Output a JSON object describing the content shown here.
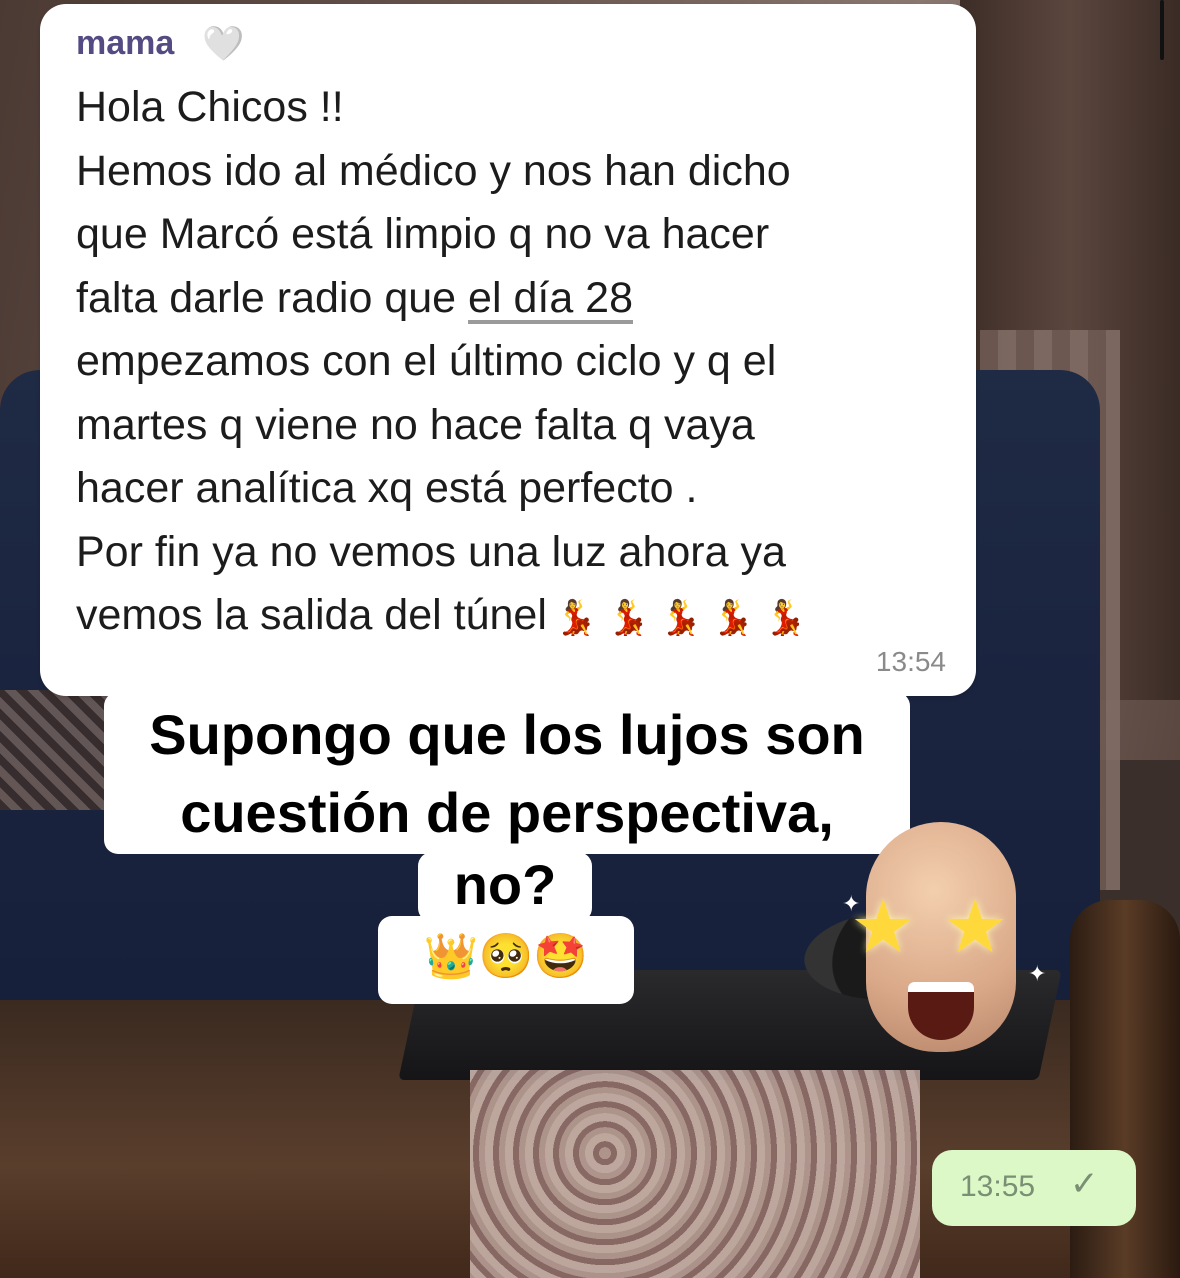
{
  "chat": {
    "incoming": {
      "sender": "mama",
      "sender_emoji": "🤍",
      "lines": [
        "Hola Chicos !!",
        "Hemos ido al médico y nos han dicho",
        "que Marcó está limpio q no va hacer",
        "falta darle radio que ",
        "el día 28",
        "empezamos con el último ciclo y q el",
        "martes q viene no hace falta q vaya",
        "hacer analítica xq está perfecto .",
        "Por fin ya no vemos una luz ahora ya",
        "vemos la salida del túnel"
      ],
      "emojis": "💃💃💃💃💃",
      "time": "13:54"
    },
    "outgoing": {
      "time": "13:55",
      "status_icon": "check-icon"
    }
  },
  "caption": {
    "line1": "Supongo que los lujos son",
    "line2": "cuestión de perspectiva,",
    "line3": "no?",
    "emojis": "👑🥺🤩"
  },
  "memoji": {
    "stars": "★",
    "sparkle": "✦"
  }
}
